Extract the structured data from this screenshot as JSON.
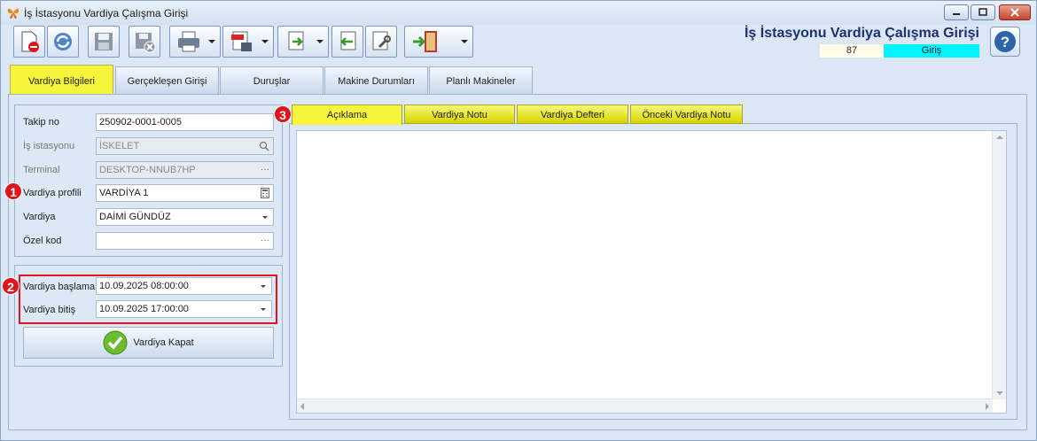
{
  "window": {
    "title": "İş İstasyonu Vardiya Çalışma Girişi",
    "controls": [
      "minimize-icon",
      "maximize-icon",
      "close-icon"
    ]
  },
  "toolbar": {
    "buttons": [
      {
        "name": "new-document-icon"
      },
      {
        "name": "refresh-icon"
      },
      {
        "name": "save-icon"
      },
      {
        "name": "save-close-icon"
      },
      {
        "name": "print-icon",
        "dropdown": true
      },
      {
        "name": "pdf-export-icon",
        "dropdown": true
      },
      {
        "name": "import-icon",
        "dropdown": true
      },
      {
        "name": "back-icon"
      },
      {
        "name": "tools-icon"
      },
      {
        "name": "exit-icon",
        "dropdown": true
      }
    ]
  },
  "header": {
    "title": "İş İstasyonu Vardiya Çalışma Girişi",
    "number": "87",
    "mode": "Giriş",
    "mode_color": "#00f5ff"
  },
  "main_tabs": [
    {
      "label": "Vardiya Bilgileri",
      "active": true
    },
    {
      "label": "Gerçekleşen Girişi"
    },
    {
      "label": "Duruşlar"
    },
    {
      "label": "Makine Durumları"
    },
    {
      "label": "Planlı Makineler"
    }
  ],
  "form": {
    "takip_no": {
      "label": "Takip no",
      "value": "250902-0001-0005"
    },
    "is_istasyonu": {
      "label": "İş istasyonu",
      "value": "İSKELET"
    },
    "terminal": {
      "label": "Terminal",
      "value": "DESKTOP-NNUB7HP"
    },
    "vardiya_profili": {
      "label": "Vardiya profili",
      "value": "VARDİYA 1"
    },
    "vardiya": {
      "label": "Vardiya",
      "value": "DAİMİ GÜNDÜZ"
    },
    "ozel_kod": {
      "label": "Özel kod",
      "value": ""
    },
    "baslama": {
      "label": "Vardiya başlama",
      "value": "10.09.2025 08:00:00"
    },
    "bitis": {
      "label": "Vardiya bitiş",
      "value": "10.09.2025 17:00:00"
    },
    "kapat_label": "Vardiya Kapat",
    "ellipsis": "···"
  },
  "badges": [
    "1",
    "2",
    "3"
  ],
  "sub_tabs": [
    {
      "label": "Açıklama",
      "active": true
    },
    {
      "label": "Vardiya Notu"
    },
    {
      "label": "Vardiya Defteri"
    },
    {
      "label": "Önceki Vardiya Notu"
    }
  ],
  "editor": {
    "text": ""
  }
}
